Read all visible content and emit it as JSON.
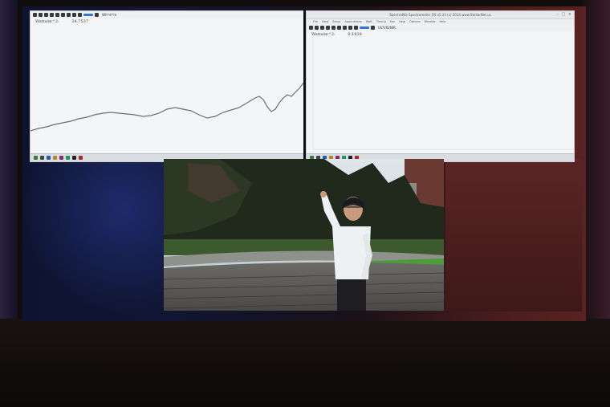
{
  "left_window": {
    "toolbar_label": "Wh*m*m",
    "readout_label": "Watts/m^2:",
    "readout_value": "24.7537"
  },
  "right_window": {
    "title": "SpectraWiz Spectrometer OS v5.33 (c) 2014   www.StellarNet.us",
    "menu": [
      "File",
      "View",
      "Setup",
      "Applications",
      "Watt",
      "Timing",
      "Sav",
      "Help",
      "Options",
      "Window",
      "Help"
    ],
    "toolbar_label": "UV/VIS/NIR",
    "readout_label": "Watts/m^2:",
    "readout_value": "0.1818"
  },
  "colors": {
    "screen_bg": "#f4f5f6",
    "trace": "#6e6e6e",
    "toolbar_accent": "#2f7bd6",
    "wall_blue": "#101634",
    "wall_red": "#5b2525"
  },
  "taskbar_icons": [
    "app-icon",
    "folder-icon",
    "mail-icon",
    "browser-icon",
    "media-icon",
    "chat-icon",
    "terminal-icon",
    "office-icon"
  ]
}
